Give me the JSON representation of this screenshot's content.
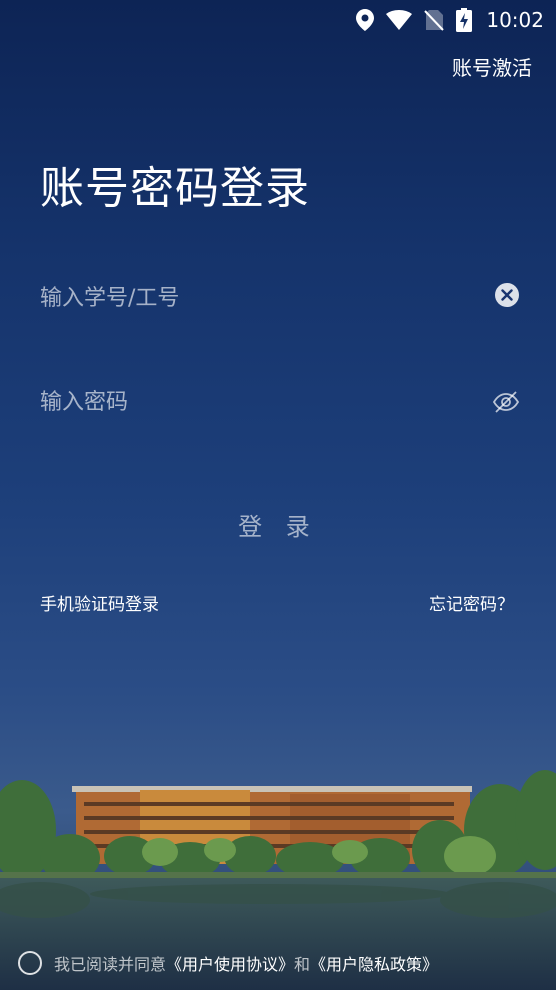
{
  "status_bar": {
    "time": "10:02",
    "icons": [
      "location-icon",
      "wifi-icon",
      "no-sim-icon",
      "battery-charging-icon"
    ]
  },
  "header": {
    "activate_label": "账号激活",
    "title": "账号密码登录"
  },
  "form": {
    "account_placeholder": "输入学号/工号",
    "account_value": "",
    "password_placeholder": "输入密码",
    "password_value": "",
    "clear_icon": "clear-icon",
    "visibility_icon": "eye-off-icon",
    "login_label": "登 录"
  },
  "links": {
    "sms_login": "手机验证码登录",
    "forgot_password": "忘记密码？"
  },
  "agreement": {
    "prefix": "我已阅读并同意",
    "user_agreement": "《用户使用协议》",
    "conjunction": "和",
    "privacy_policy": "《用户隐私政策》",
    "checked": false
  },
  "colors": {
    "background_top": "#0d2455",
    "background_mid": "#1d3f7a",
    "text": "#ffffff"
  }
}
